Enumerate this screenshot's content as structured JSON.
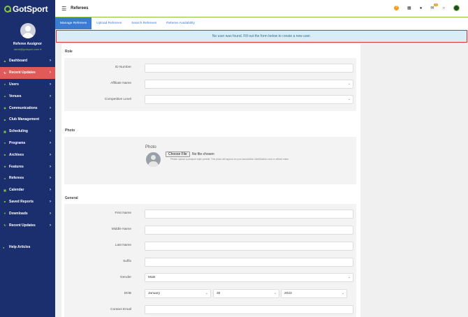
{
  "app": {
    "name": "GotSport"
  },
  "profile": {
    "name": "Referee Assignor",
    "email": "david@gotsport.com ▾"
  },
  "sidebar": {
    "items": [
      {
        "label": "Dashboard",
        "icon": "dashboard-icon",
        "glyph": "■"
      },
      {
        "label": "Recent Updates",
        "icon": "refresh-icon",
        "glyph": "↻",
        "active": true
      },
      {
        "label": "Users",
        "icon": "users-icon",
        "glyph": "●"
      },
      {
        "label": "Venues",
        "icon": "venue-icon",
        "glyph": "▲"
      },
      {
        "label": "Communications",
        "icon": "chat-icon",
        "glyph": "◆"
      },
      {
        "label": "Club Management",
        "icon": "club-icon",
        "glyph": "■"
      },
      {
        "label": "Scheduling",
        "icon": "calendar-icon",
        "glyph": "▣"
      },
      {
        "label": "Programs",
        "icon": "programs-icon",
        "glyph": "●"
      },
      {
        "label": "Archives",
        "icon": "archive-icon",
        "glyph": "■"
      },
      {
        "label": "Features",
        "icon": "star-icon",
        "glyph": "★"
      },
      {
        "label": "Referees",
        "icon": "whistle-icon",
        "glyph": "●"
      },
      {
        "label": "Calendar",
        "icon": "calendar-icon",
        "glyph": "▣"
      },
      {
        "label": "Saved Reports",
        "icon": "report-icon",
        "glyph": "■"
      },
      {
        "label": "Downloads",
        "icon": "download-icon",
        "glyph": "▼"
      },
      {
        "label": "Recent Updates",
        "icon": "refresh-icon",
        "glyph": "↻"
      }
    ],
    "help": {
      "label": "Help Articles",
      "icon": "help-circle-icon",
      "glyph": "●"
    }
  },
  "header": {
    "title": "Referees",
    "menu_icon": "hamburger-icon",
    "mail_badge": "9"
  },
  "tabs": [
    {
      "label": "Manage Referees",
      "active": true
    },
    {
      "label": "Upload Referees"
    },
    {
      "label": "Search Referees"
    },
    {
      "label": "Referee Availability"
    }
  ],
  "alert": {
    "message": "No user was found. Fill out the form below to create a new user."
  },
  "role": {
    "title": "Role",
    "id_label": "ID Number",
    "id_value": "",
    "affiliate_label": "Affiliate Name",
    "affiliate_value": "",
    "level_label": "Competitive Level",
    "level_value": ""
  },
  "photo": {
    "title": "Photo",
    "label": "Photo",
    "choose_label": "Choose File",
    "no_file": "No file chosen",
    "hint": "Please upload a passport style portrait. This photo will appear on your association identification card or official roster."
  },
  "general": {
    "title": "General",
    "first_name_label": "First Name",
    "middle_name_label": "Middle Name",
    "last_name_label": "Last Name",
    "suffix_label": "Suffix",
    "gender_label": "Gender",
    "gender_value": "Male",
    "dob_label": "DOB",
    "dob_month": "January",
    "dob_day": "30",
    "dob_year": "2023",
    "email_label": "Contact Email"
  },
  "colors": {
    "sidebar": "#1b2f6e",
    "accent": "#8bc53f",
    "active_nav": "#e05a5a",
    "tab_active": "#3a7bd5",
    "alert_border": "#e03030"
  }
}
